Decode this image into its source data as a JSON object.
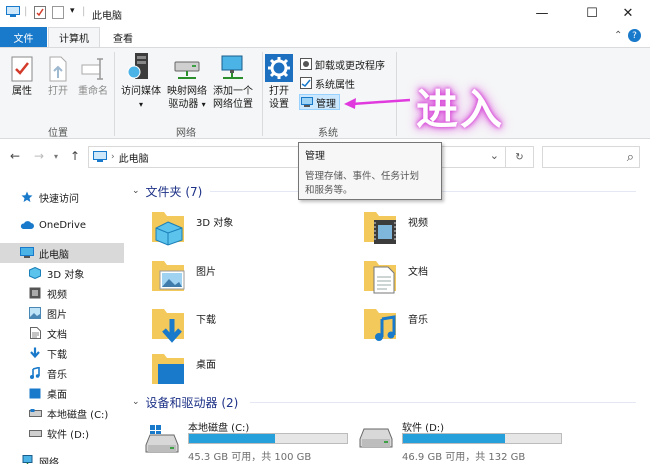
{
  "window": {
    "title": "此电脑",
    "minimize": "—",
    "maximize": "☐",
    "close": "✕"
  },
  "tabs": {
    "file": "文件",
    "computer": "计算机",
    "view": "查看",
    "collapse": "⌃",
    "help": "?"
  },
  "ribbon": {
    "location": {
      "properties": "属性",
      "open": "打开",
      "rename": "重命名",
      "label": "位置"
    },
    "network": {
      "access_media": "访问媒体",
      "map_drive_1": "映射网络",
      "map_drive_2": "驱动器",
      "add_location_1": "添加一个",
      "add_location_2": "网络位置",
      "label": "网络"
    },
    "system": {
      "open_settings_1": "打开",
      "open_settings_2": "设置",
      "uninstall": "卸载或更改程序",
      "system_properties": "系统属性",
      "manage": "管理",
      "label": "系统"
    }
  },
  "annotation": {
    "text": "进入",
    "color": "#d74ad8"
  },
  "navigation": {
    "back": "←",
    "forward": "→",
    "up": "↑",
    "address": "此电脑",
    "refresh": "↻",
    "search_icon": "⌕",
    "dropdown": "⌄"
  },
  "sidebar": {
    "items": [
      {
        "label": "快速访问",
        "icon": "star-icon"
      },
      {
        "label": "OneDrive",
        "icon": "cloud-icon"
      },
      {
        "label": "此电脑",
        "icon": "computer-icon"
      },
      {
        "label": "3D 对象",
        "icon": "cube-icon"
      },
      {
        "label": "视频",
        "icon": "video-icon"
      },
      {
        "label": "图片",
        "icon": "picture-icon"
      },
      {
        "label": "文档",
        "icon": "document-icon"
      },
      {
        "label": "下载",
        "icon": "download-icon"
      },
      {
        "label": "音乐",
        "icon": "music-icon"
      },
      {
        "label": "桌面",
        "icon": "desktop-icon"
      },
      {
        "label": "本地磁盘 (C:)",
        "icon": "drive-c-icon"
      },
      {
        "label": "软件 (D:)",
        "icon": "drive-d-icon"
      },
      {
        "label": "网络",
        "icon": "network-icon"
      }
    ]
  },
  "folders": {
    "header": "文件夹 (7)",
    "items": [
      {
        "label": "3D 对象"
      },
      {
        "label": "视频"
      },
      {
        "label": "图片"
      },
      {
        "label": "文档"
      },
      {
        "label": "下载"
      },
      {
        "label": "音乐"
      },
      {
        "label": "桌面"
      }
    ]
  },
  "devices": {
    "header": "设备和驱动器 (2)",
    "drives": [
      {
        "name": "本地磁盘 (C:)",
        "free": "45.3 GB 可用，共 100 GB",
        "used_fraction": 0.547
      },
      {
        "name": "软件 (D:)",
        "free": "46.9 GB 可用，共 132 GB",
        "used_fraction": 0.645
      }
    ]
  },
  "tooltip": {
    "title": "管理",
    "desc_1": "管理存储、事件、任务计划",
    "desc_2": "和服务等。"
  },
  "colors": {
    "accent": "#1979ca",
    "selection": "#cce8ff",
    "drive_bar": "#26a0da",
    "folder": "#f3c95b"
  }
}
